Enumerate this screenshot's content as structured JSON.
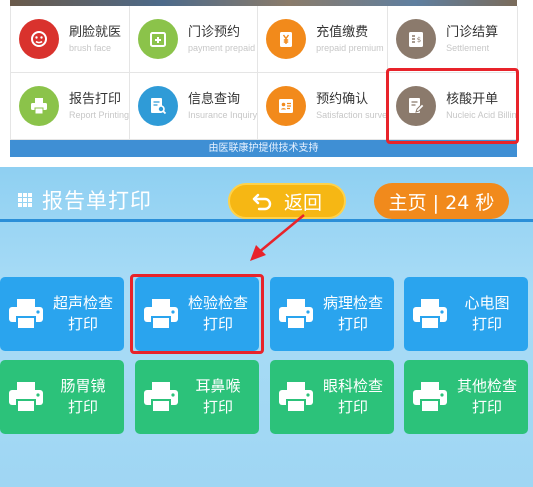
{
  "kiosk_menu": {
    "items": [
      {
        "cn": "刷脸就医",
        "en": "brush face",
        "icon": "face-scan-icon",
        "color": "#d9322d"
      },
      {
        "cn": "门诊预约",
        "en": "payment prepaid",
        "icon": "calendar-plus-icon",
        "color": "#8bc34a"
      },
      {
        "cn": "充值缴费",
        "en": "prepaid premium",
        "icon": "yuan-card-icon",
        "color": "#f28a1b"
      },
      {
        "cn": "门诊结算",
        "en": "Settlement",
        "icon": "invoice-icon",
        "color": "#8b7a6c"
      },
      {
        "cn": "报告打印",
        "en": "Report Printing",
        "icon": "printer-icon",
        "color": "#8bc34a"
      },
      {
        "cn": "信息查询",
        "en": "Insurance Inquiry",
        "icon": "document-search-icon",
        "color": "#2f9bd7"
      },
      {
        "cn": "预约确认",
        "en": "Satisfaction surve",
        "icon": "contact-card-icon",
        "color": "#f28a1b"
      },
      {
        "cn": "核酸开单",
        "en": "Nucleic Acid Billin",
        "icon": "edit-form-icon",
        "color": "#8b7a6c"
      }
    ],
    "footer": "由医联康护提供技术支持"
  },
  "print_screen": {
    "title": "报告单打印",
    "back_label": "返回",
    "home_label": "主页 | 24 秒",
    "tiles": [
      {
        "line1": "超声检查",
        "line2": "打印",
        "color": "blue"
      },
      {
        "line1": "检验检查",
        "line2": "打印",
        "color": "blue"
      },
      {
        "line1": "病理检查",
        "line2": "打印",
        "color": "blue"
      },
      {
        "line1": "心电图",
        "line2": "打印",
        "color": "blue"
      },
      {
        "line1": "肠胃镜",
        "line2": "打印",
        "color": "green"
      },
      {
        "line1": "耳鼻喉",
        "line2": "打印",
        "color": "green"
      },
      {
        "line1": "眼科检查",
        "line2": "打印",
        "color": "green"
      },
      {
        "line1": "其他检查",
        "line2": "打印",
        "color": "green"
      }
    ]
  },
  "colors": {
    "accent_blue": "#2aa4ee",
    "accent_green": "#2cc27a",
    "back_yellow": "#f6b714",
    "home_orange": "#f18a1c",
    "highlight_red": "#e8232a"
  }
}
